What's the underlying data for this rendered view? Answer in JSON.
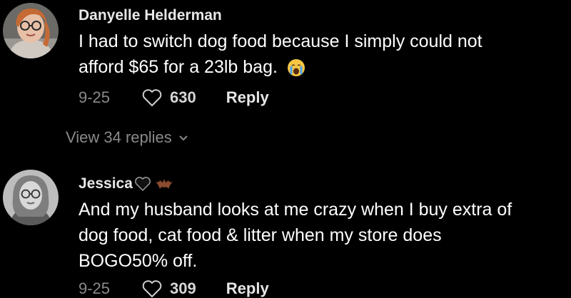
{
  "comments": [
    {
      "username": "Danyelle Helderman",
      "text_line1": "I had to switch dog food because I simply could not",
      "text_line2": "afford $65 for a 23lb bag.",
      "emoji_icon": "crying-face-icon",
      "date": "9-25",
      "likes": "630",
      "reply_label": "Reply",
      "view_replies_label": "View 34 replies"
    },
    {
      "username": "Jessica",
      "username_badges": [
        "black-heart-icon",
        "bat-icon"
      ],
      "text_line1": "And my husband looks at me crazy when I buy extra of",
      "text_line2": "dog food, cat food & litter when my store does",
      "text_line3": "BOGO50% off.",
      "date": "9-25",
      "likes": "309",
      "reply_label": "Reply"
    }
  ],
  "colors": {
    "background": "#000000",
    "text": "#ffffff",
    "muted": "#8a8a8a"
  }
}
